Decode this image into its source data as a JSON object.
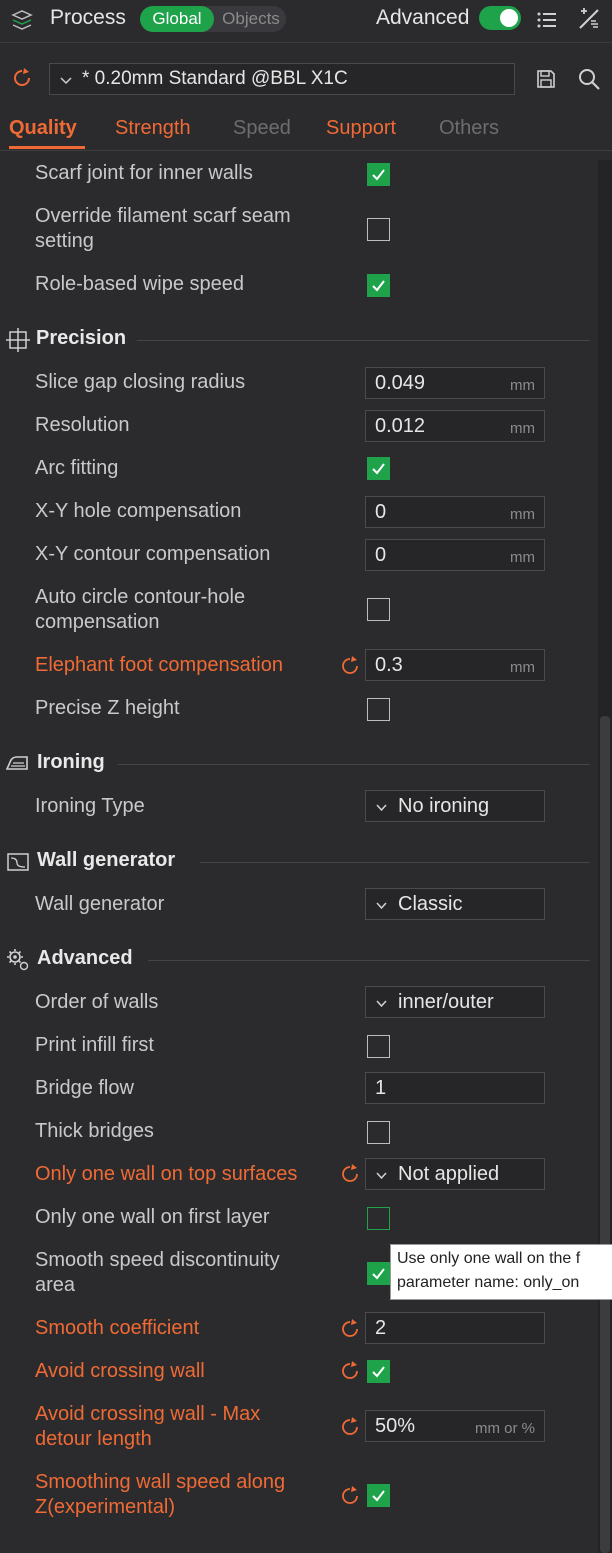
{
  "header": {
    "title": "Process",
    "scope_global": "Global",
    "scope_objects": "Objects",
    "advanced_label": "Advanced",
    "advanced_enabled": true
  },
  "preset": {
    "name": "* 0.20mm Standard @BBL X1C"
  },
  "tabs": [
    {
      "label": "Quality",
      "state": "active"
    },
    {
      "label": "Strength",
      "state": "modified"
    },
    {
      "label": "Speed",
      "state": "normal"
    },
    {
      "label": "Support",
      "state": "modified"
    },
    {
      "label": "Others",
      "state": "normal"
    }
  ],
  "sections": {
    "precision": "Precision",
    "ironing": "Ironing",
    "wall_generator": "Wall generator",
    "advanced": "Advanced"
  },
  "rows": {
    "scarf_inner": {
      "label": "Scarf joint for inner walls",
      "checked": true
    },
    "override_scarf": {
      "label_line1": "Override filament scarf seam",
      "label_line2": "setting",
      "checked": false
    },
    "role_wipe": {
      "label": "Role-based wipe speed",
      "checked": true
    },
    "slice_gap": {
      "label": "Slice gap closing radius",
      "value": "0.049",
      "unit": "mm"
    },
    "resolution": {
      "label": "Resolution",
      "value": "0.012",
      "unit": "mm"
    },
    "arc_fitting": {
      "label": "Arc fitting",
      "checked": true
    },
    "xy_hole": {
      "label": "X-Y hole compensation",
      "value": "0",
      "unit": "mm"
    },
    "xy_contour": {
      "label": "X-Y contour compensation",
      "value": "0",
      "unit": "mm"
    },
    "auto_circle": {
      "label_line1": "Auto circle contour-hole",
      "label_line2": "compensation",
      "checked": false
    },
    "elephant_foot": {
      "label": "Elephant foot compensation",
      "value": "0.3",
      "unit": "mm",
      "modified": true
    },
    "precise_z": {
      "label": "Precise Z height",
      "checked": false
    },
    "ironing_type": {
      "label": "Ironing Type",
      "value": "No ironing"
    },
    "wall_gen": {
      "label": "Wall generator",
      "value": "Classic"
    },
    "order_walls": {
      "label": "Order of walls",
      "value": "inner/outer"
    },
    "infill_first": {
      "label": "Print infill first",
      "checked": false
    },
    "bridge_flow": {
      "label": "Bridge flow",
      "value": "1"
    },
    "thick_bridges": {
      "label": "Thick bridges",
      "checked": false
    },
    "one_wall_top": {
      "label": "Only one wall on top surfaces",
      "value": "Not applied",
      "modified": true
    },
    "one_wall_first": {
      "label": "Only one wall on first layer",
      "checked": false
    },
    "smooth_speed": {
      "label_line1": "Smooth speed discontinuity",
      "label_line2": "area",
      "checked": true
    },
    "smooth_coef": {
      "label": "Smooth coefficient",
      "value": "2",
      "modified": true
    },
    "avoid_crossing": {
      "label": "Avoid crossing wall",
      "checked": true,
      "modified": true
    },
    "avoid_detour": {
      "label_line1": "Avoid crossing wall - Max",
      "label_line2": "detour length",
      "value": "50%",
      "unit": "mm or %",
      "modified": true
    },
    "smooth_z": {
      "label_line1": "Smoothing wall speed along",
      "label_line2": "Z(experimental)",
      "checked": true,
      "modified": true
    }
  },
  "tooltip": {
    "line1": "Use only one wall on the f",
    "line2": "parameter name: only_on"
  },
  "colors": {
    "accent": "#1fa34a",
    "modified": "#ef6a34",
    "background": "#2b2b2e"
  }
}
